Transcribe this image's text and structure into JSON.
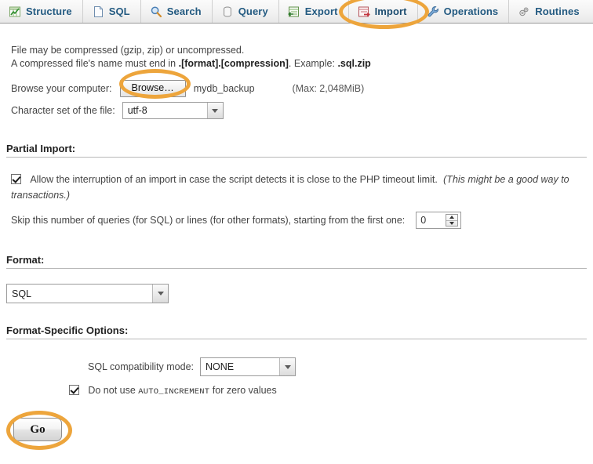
{
  "tabs": [
    {
      "label": "Structure",
      "icon": "structure-icon",
      "active": false
    },
    {
      "label": "SQL",
      "icon": "sql-icon",
      "active": false
    },
    {
      "label": "Search",
      "icon": "search-icon",
      "active": false
    },
    {
      "label": "Query",
      "icon": "query-icon",
      "active": false
    },
    {
      "label": "Export",
      "icon": "export-icon",
      "active": false
    },
    {
      "label": "Import",
      "icon": "import-icon",
      "active": true
    },
    {
      "label": "Operations",
      "icon": "wrench-icon",
      "active": false
    },
    {
      "label": "Routines",
      "icon": "gears-icon",
      "active": false
    }
  ],
  "file_to_import": {
    "line1": "File may be compressed (gzip, zip) or uncompressed.",
    "line2_prefix": "A compressed file's name must end in ",
    "line2_bold1": ".[format].[compression]",
    "line2_mid": ". Example: ",
    "line2_bold2": ".sql.zip",
    "browse_label": "Browse your computer:",
    "browse_button": "Browse…",
    "selected_file": "mydb_backup",
    "max_size": "(Max: 2,048MiB)",
    "charset_label": "Character set of the file:",
    "charset_value": "utf-8"
  },
  "partial_import": {
    "heading": "Partial Import:",
    "allow_interrupt_checked": true,
    "allow_interrupt_text": "Allow the interruption of an import in case the script detects it is close to the PHP timeout limit.",
    "allow_interrupt_note": "(This might be a good way to",
    "allow_interrupt_note_wrap": "transactions.)",
    "skip_label": "Skip this number of queries (for SQL) or lines (for other formats), starting from the first one:",
    "skip_value": "0"
  },
  "format": {
    "heading": "Format:",
    "value": "SQL"
  },
  "format_specific": {
    "heading": "Format-Specific Options:",
    "compat_label": "SQL compatibility mode:",
    "compat_value": "NONE",
    "auto_increment_checked": true,
    "auto_increment_prefix": "Do not use ",
    "auto_increment_keyword": "AUTO_INCREMENT",
    "auto_increment_suffix": " for zero values"
  },
  "submit": {
    "go_label": "Go"
  },
  "annotations": {
    "color": "#eda53c",
    "targets": [
      "import-tab",
      "browse-button",
      "go-button"
    ]
  }
}
